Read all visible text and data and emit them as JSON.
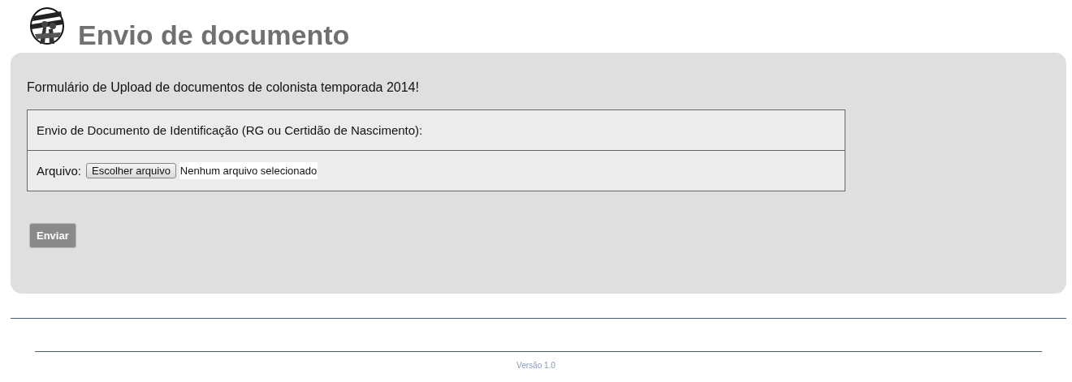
{
  "header": {
    "title": "Envio de documento"
  },
  "form": {
    "intro": "Formulário de Upload de documentos de colonista temporada 2014!",
    "section_title": "Envio de Documento de Identificação (RG ou Certidão de Nascimento):",
    "file_label": "Arquivo:",
    "file_button": "Escolher arquivo",
    "file_status": "Nenhum arquivo selecionado",
    "submit": "Enviar"
  },
  "footer": {
    "version": "Versão 1.0"
  }
}
